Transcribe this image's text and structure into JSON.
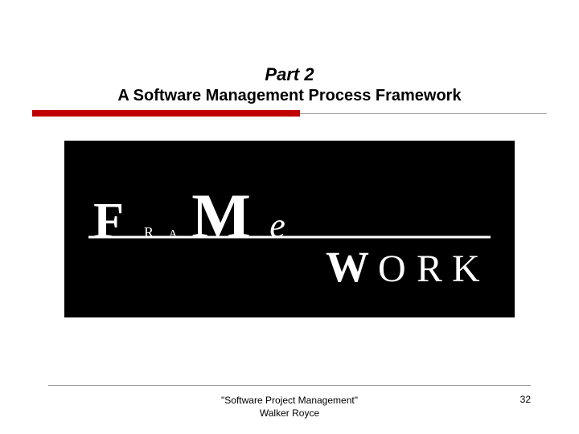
{
  "title": {
    "part": "Part 2",
    "subtitle": "A Software Management Process Framework"
  },
  "figure": {
    "text_upper": "FraMe",
    "text_lower": "work",
    "description": "framework-wordmark"
  },
  "footer": {
    "book": "\"Software Project Management\"",
    "author": "Walker Royce",
    "page": "32"
  },
  "colors": {
    "accent": "#c00000",
    "bg": "#ffffff",
    "figure_bg": "#000000"
  }
}
